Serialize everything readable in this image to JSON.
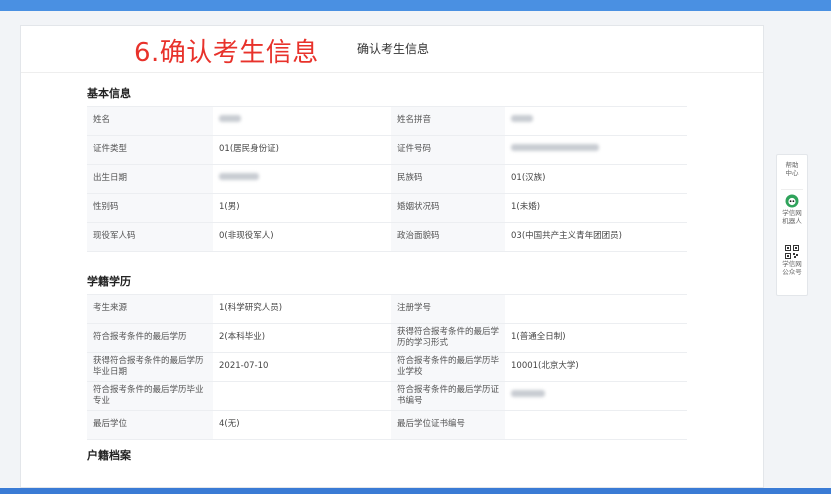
{
  "header": {
    "step_title": "6.确认考生信息",
    "subtitle": "确认考生信息"
  },
  "sections": {
    "basic": {
      "title": "基本信息",
      "rows": [
        {
          "l1": "姓名",
          "v1": "",
          "l2": "姓名拼音",
          "v2": ""
        },
        {
          "l1": "证件类型",
          "v1": "01(居民身份证)",
          "l2": "证件号码",
          "v2": ""
        },
        {
          "l1": "出生日期",
          "v1": "",
          "l2": "民族码",
          "v2": "01(汉族)"
        },
        {
          "l1": "性别码",
          "v1": "1(男)",
          "l2": "婚姻状况码",
          "v2": "1(未婚)"
        },
        {
          "l1": "现役军人码",
          "v1": "0(非现役军人)",
          "l2": "政治面貌码",
          "v2": "03(中国共产主义青年团团员)"
        }
      ]
    },
    "education": {
      "title": "学籍学历",
      "rows": [
        {
          "l1": "考生来源",
          "v1": "1(科学研究人员)",
          "l2": "注册学号",
          "v2": ""
        },
        {
          "l1": "符合报考条件的最后学历",
          "v1": "2(本科毕业)",
          "l2": "获得符合报考条件的最后学历的学习形式",
          "v2": "1(普通全日制)"
        },
        {
          "l1": "获得符合报考条件的最后学历毕业日期",
          "v1": "2021-07-10",
          "l2": "符合报考条件的最后学历毕业学校",
          "v2": "10001(北京大学)"
        },
        {
          "l1": "符合报考条件的最后学历毕业专业",
          "v1": "",
          "l2": "符合报考条件的最后学历证书编号",
          "v2": ""
        },
        {
          "l1": "最后学位",
          "v1": "4(无)",
          "l2": "最后学位证书编号",
          "v2": ""
        }
      ]
    },
    "household": {
      "title": "户籍档案"
    }
  },
  "sidebar": {
    "help": "帮助中心",
    "robot": "学信网机器人",
    "official": "学信网公众号"
  },
  "colors": {
    "accent": "#4a90e2",
    "step_red": "#e8322b"
  }
}
